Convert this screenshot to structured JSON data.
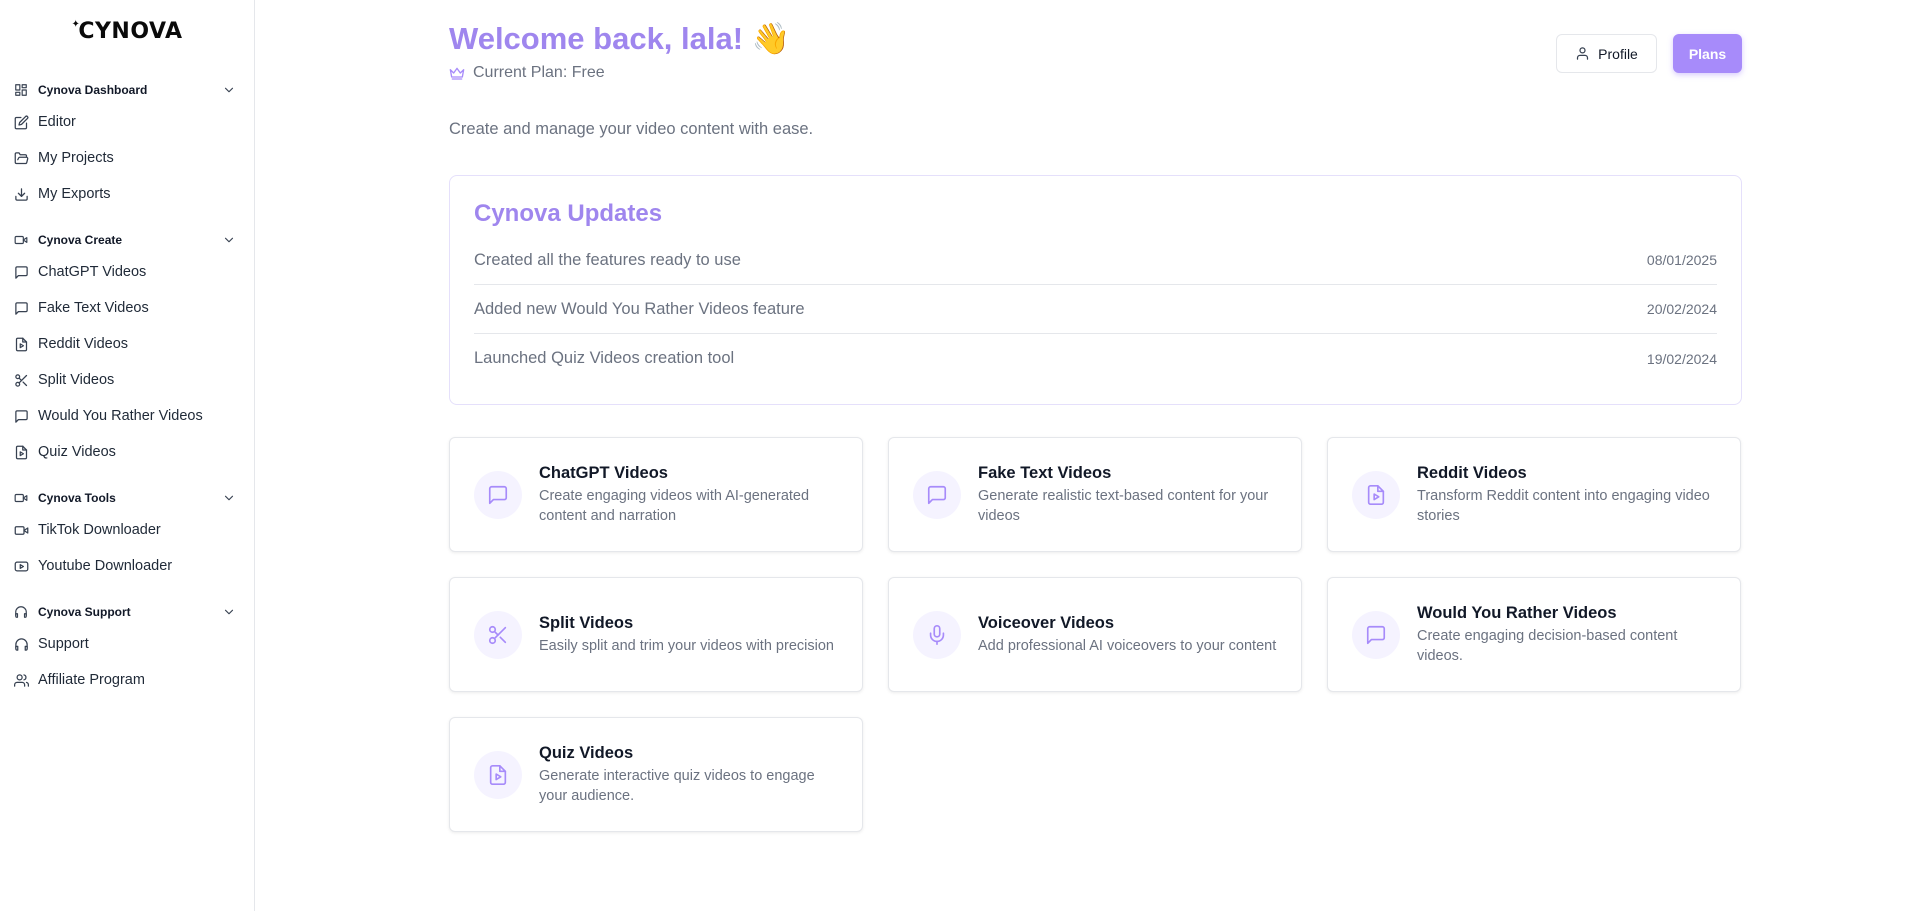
{
  "app": {
    "logo_text": "CYNOVA"
  },
  "sidebar": {
    "groups": [
      {
        "label": "Cynova Dashboard",
        "items": [
          {
            "label": "Editor"
          },
          {
            "label": "My Projects"
          },
          {
            "label": "My Exports"
          }
        ]
      },
      {
        "label": "Cynova Create",
        "items": [
          {
            "label": "ChatGPT Videos"
          },
          {
            "label": "Fake Text Videos"
          },
          {
            "label": "Reddit Videos"
          },
          {
            "label": "Split Videos"
          },
          {
            "label": "Would You Rather Videos"
          },
          {
            "label": "Quiz Videos"
          }
        ]
      },
      {
        "label": "Cynova Tools",
        "items": [
          {
            "label": "TikTok Downloader"
          },
          {
            "label": "Youtube Downloader"
          }
        ]
      },
      {
        "label": "Cynova Support",
        "items": [
          {
            "label": "Support"
          },
          {
            "label": "Affiliate Program"
          }
        ]
      }
    ]
  },
  "header": {
    "welcome": "Welcome back, lala! 👋",
    "plan": "Current Plan: Free",
    "profile_label": "Profile",
    "plans_label": "Plans",
    "subtitle": "Create and manage your video content with ease."
  },
  "updates": {
    "title": "Cynova Updates",
    "items": [
      {
        "text": "Created all the features ready to use",
        "date": "08/01/2025"
      },
      {
        "text": "Added new Would You Rather Videos feature",
        "date": "20/02/2024"
      },
      {
        "text": "Launched Quiz Videos creation tool",
        "date": "19/02/2024"
      }
    ]
  },
  "cards": [
    {
      "title": "ChatGPT Videos",
      "desc": "Create engaging videos with AI-generated content and narration",
      "icon": "message-square-icon"
    },
    {
      "title": "Fake Text Videos",
      "desc": "Generate realistic text-based content for your videos",
      "icon": "message-square-icon"
    },
    {
      "title": "Reddit Videos",
      "desc": "Transform Reddit content into engaging video stories",
      "icon": "file-video-icon"
    },
    {
      "title": "Split Videos",
      "desc": "Easily split and trim your videos with precision",
      "icon": "scissors-icon"
    },
    {
      "title": "Voiceover Videos",
      "desc": "Add professional AI voiceovers to your content",
      "icon": "mic-icon"
    },
    {
      "title": "Would You Rather Videos",
      "desc": "Create engaging decision-based content videos.",
      "icon": "message-square-icon"
    },
    {
      "title": "Quiz Videos",
      "desc": "Generate interactive quiz videos to engage your audience.",
      "icon": "file-video-icon"
    }
  ],
  "colors": {
    "accent": "#a78bfa",
    "heading_accent": "#9f86ee",
    "muted_text": "#6b7280",
    "icon_bg": "#f5f3ff"
  }
}
